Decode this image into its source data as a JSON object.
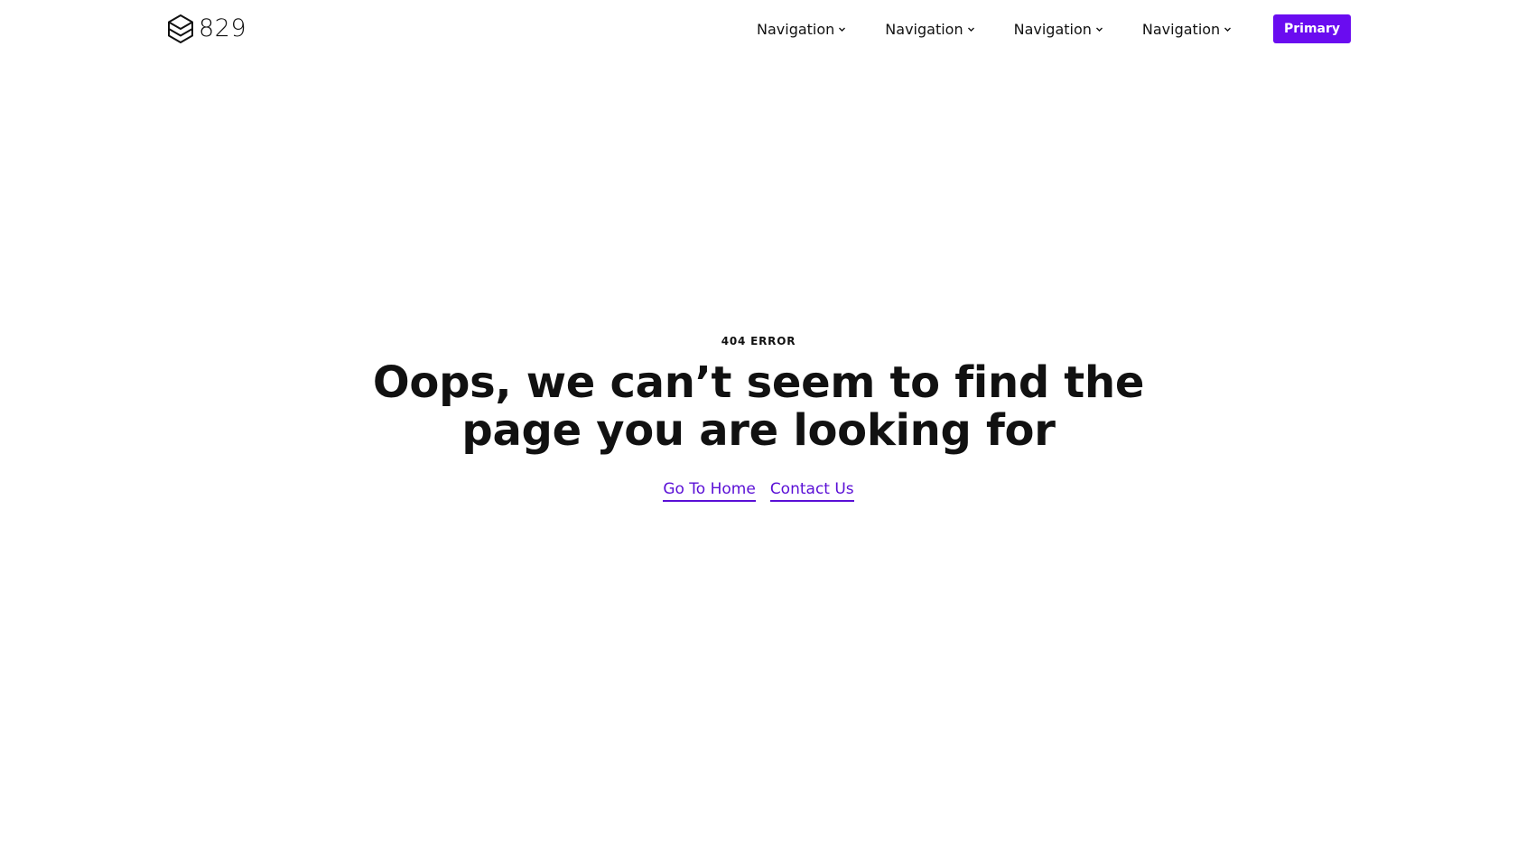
{
  "header": {
    "logo_text": "829",
    "nav_items": [
      {
        "label": "Navigation",
        "icon": "chevron-down-icon"
      },
      {
        "label": "Navigation",
        "icon": "chevron-down-icon"
      },
      {
        "label": "Navigation",
        "icon": "chevron-down-icon"
      },
      {
        "label": "Navigation",
        "icon": "chevron-down-icon"
      }
    ],
    "primary_button": "Primary"
  },
  "hero": {
    "eyebrow": "404 ERROR",
    "headline": "Oops, we can’t seem to find the page you are looking for",
    "links": [
      {
        "label": "Go To Home"
      },
      {
        "label": "Contact Us"
      }
    ]
  },
  "colors": {
    "accent": "#6a0cf0",
    "link": "#5a0fd6",
    "text": "#111111",
    "background": "#ffffff"
  }
}
